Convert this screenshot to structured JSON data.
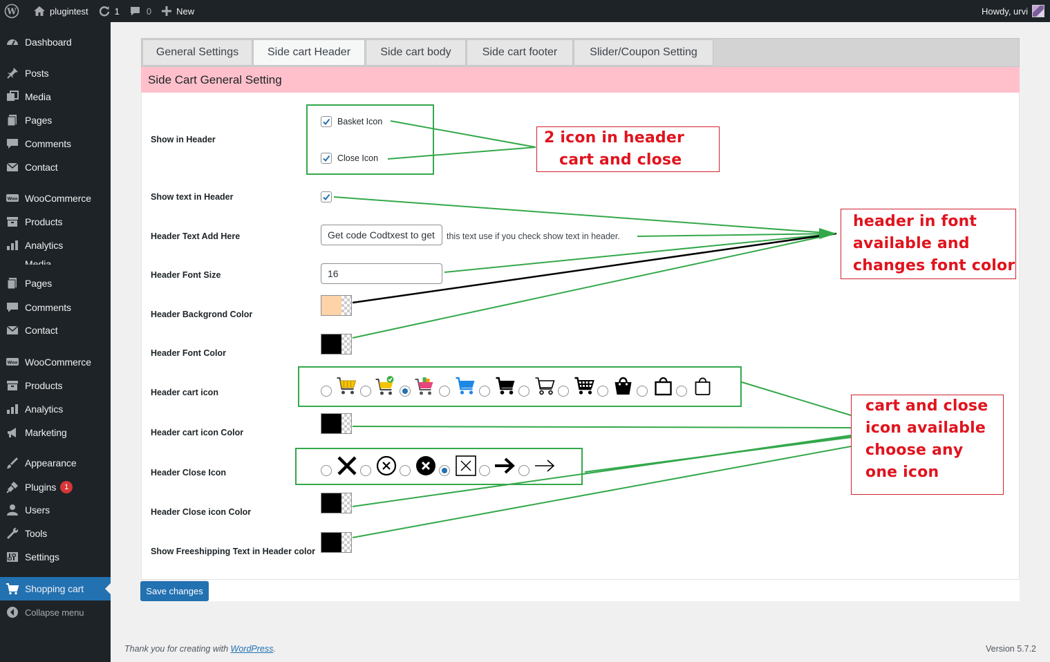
{
  "admin_bar": {
    "site_name": "plugintest",
    "updates_count": "1",
    "comments_count": "0",
    "new_label": "New",
    "howdy": "Howdy, urvi"
  },
  "sidebar": {
    "items": [
      {
        "label": "Dashboard",
        "icon": "dashboard-icon"
      },
      {
        "label": "Posts",
        "icon": "pin-icon"
      },
      {
        "label": "Media",
        "icon": "media-icon"
      },
      {
        "label": "Pages",
        "icon": "pages-icon"
      },
      {
        "label": "Comments",
        "icon": "comment-icon"
      },
      {
        "label": "Contact",
        "icon": "mail-icon"
      },
      {
        "label": "WooCommerce",
        "icon": "woo-icon"
      },
      {
        "label": "Products",
        "icon": "archive-icon"
      },
      {
        "label": "Analytics",
        "icon": "bar-chart-icon"
      },
      {
        "label": "Pages",
        "icon": "pages-icon"
      },
      {
        "label": "Comments",
        "icon": "comment-icon"
      },
      {
        "label": "Contact",
        "icon": "mail-icon"
      },
      {
        "label": "WooCommerce",
        "icon": "woo-icon"
      },
      {
        "label": "Products",
        "icon": "archive-icon"
      },
      {
        "label": "Analytics",
        "icon": "bar-chart-icon"
      },
      {
        "label": "Marketing",
        "icon": "megaphone-icon"
      },
      {
        "label": "Appearance",
        "icon": "brush-icon"
      },
      {
        "label": "Plugins",
        "icon": "plug-icon",
        "badge": "1"
      },
      {
        "label": "Users",
        "icon": "user-icon"
      },
      {
        "label": "Tools",
        "icon": "wrench-icon"
      },
      {
        "label": "Settings",
        "icon": "settings-icon"
      },
      {
        "label": "Shopping cart",
        "icon": "cart-icon",
        "current": true
      },
      {
        "label": "Collapse menu",
        "icon": "collapse-icon"
      }
    ],
    "cut_label": "Media"
  },
  "tabs": [
    {
      "label": "General Settings"
    },
    {
      "label": "Side cart Header",
      "active": true
    },
    {
      "label": "Side cart body"
    },
    {
      "label": "Side cart footer"
    },
    {
      "label": "Slider/Coupon Setting"
    }
  ],
  "section_title": "Side Cart General Setting",
  "form": {
    "show_in_header": {
      "label": "Show in Header",
      "basket_label": "Basket Icon",
      "close_label": "Close Icon",
      "basket_checked": true,
      "close_checked": true
    },
    "show_text": {
      "label": "Show text in Header",
      "checked": true
    },
    "header_text": {
      "label": "Header Text Add Here",
      "value": "Get code Codtxest to get",
      "description": "this text use if you check show text in header."
    },
    "font_size": {
      "label": "Header Font Size",
      "value": "16"
    },
    "bg_color": {
      "label": "Header Backgrond Color",
      "color": "#fdd3a7"
    },
    "font_color": {
      "label": "Header Font Color",
      "color": "#000000"
    },
    "cart_icon": {
      "label": "Header cart icon",
      "selected_index": 2,
      "options": [
        "basket-yellow-icon",
        "cart-check-icon",
        "cart-pink-icon",
        "cart-blue-icon",
        "cart-black-icon",
        "cart-outline-icon",
        "cart-grid-icon",
        "bag-solid-icon",
        "bag-outline-icon",
        "bag-thin-icon"
      ]
    },
    "cart_icon_color": {
      "label": "Header cart icon Color",
      "color": "#000000"
    },
    "close_icon": {
      "label": "Header Close Icon",
      "selected_index": 3,
      "options": [
        "x-bold-icon",
        "x-circle-outline-icon",
        "x-circle-solid-icon",
        "x-square-icon",
        "arrow-bold-icon",
        "arrow-thin-icon"
      ]
    },
    "close_icon_color": {
      "label": "Header Close icon Color",
      "color": "#000000"
    },
    "freeship_color": {
      "label": "Show Freeshipping Text in Header color",
      "color": "#000000"
    }
  },
  "save_label": "Save changes",
  "footer": {
    "thanks_prefix": "Thank you for creating with ",
    "thanks_link": "WordPress",
    "thanks_suffix": ".",
    "version": "Version 5.7.2"
  },
  "annotations": {
    "note1": [
      "2 icon in header",
      "cart   and close"
    ],
    "note2": [
      "header in font",
      "available and",
      "changes font color"
    ],
    "note3": [
      "cart and close",
      "icon available",
      "choose any",
      "one icon"
    ],
    "green": "#33a84a",
    "red": "#e0141e"
  }
}
